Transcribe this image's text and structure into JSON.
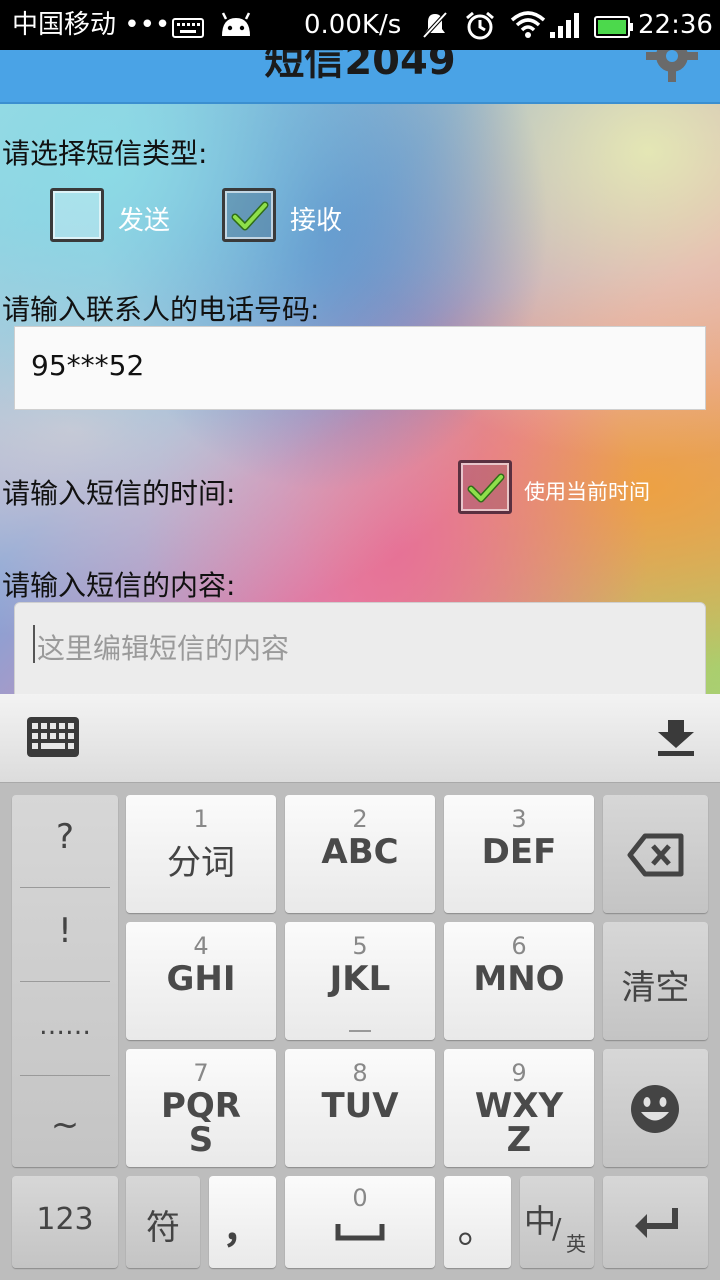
{
  "status_bar": {
    "carrier": "中国移动 •••",
    "speed": "0.00K/s",
    "time": "22:36"
  },
  "app": {
    "title": "短信2049"
  },
  "form": {
    "type_label": "请选择短信类型:",
    "send_label": "发送",
    "send_checked": false,
    "receive_label": "接收",
    "receive_checked": true,
    "phone_label": "请输入联系人的电话号码:",
    "phone_value": "95***52",
    "time_label": "请输入短信的时间:",
    "use_current_time_label": "使用当前时间",
    "use_current_time_checked": true,
    "content_label": "请输入短信的内容:",
    "content_placeholder": "这里编辑短信的内容"
  },
  "keyboard": {
    "punct": [
      "?",
      "!",
      "……",
      "~"
    ],
    "keys": [
      {
        "num": "1",
        "label": "分词"
      },
      {
        "num": "2",
        "label": "ABC"
      },
      {
        "num": "3",
        "label": "DEF"
      },
      {
        "num": "4",
        "label": "GHI"
      },
      {
        "num": "5",
        "label": "JKL"
      },
      {
        "num": "6",
        "label": "MNO"
      },
      {
        "num": "7",
        "label": "PQR\nS"
      },
      {
        "num": "8",
        "label": "TUV"
      },
      {
        "num": "9",
        "label": "WXY\nZ"
      }
    ],
    "clear_label": "清空",
    "num_toggle_label": "123",
    "symbol_label": "符",
    "comma_label": "，",
    "space_num": "0",
    "period_label": "。",
    "lang_main": "中",
    "lang_sub": "英"
  }
}
